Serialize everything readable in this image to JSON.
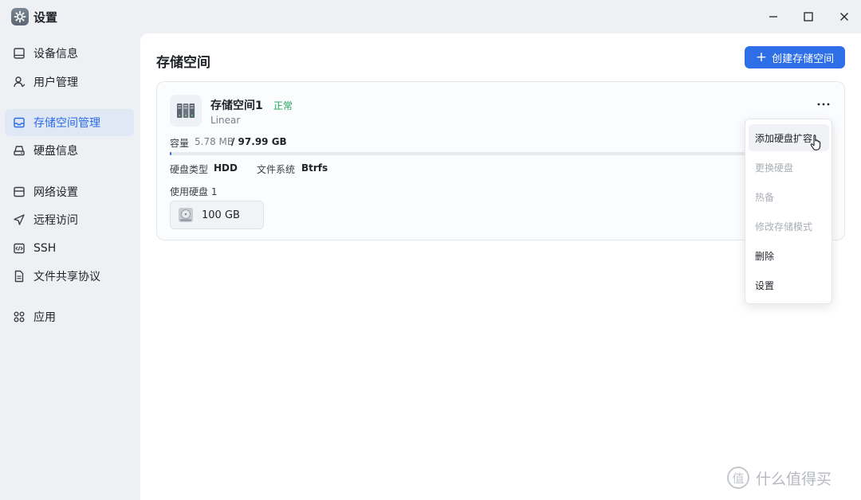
{
  "window": {
    "title": "设置"
  },
  "sidebar": {
    "items": [
      {
        "label": "设备信息",
        "icon": "device-icon",
        "active": false
      },
      {
        "label": "用户管理",
        "icon": "user-icon",
        "active": false
      },
      {
        "label": "存储空间管理",
        "icon": "storage-icon",
        "active": true
      },
      {
        "label": "硬盘信息",
        "icon": "disk-icon",
        "active": false
      },
      {
        "label": "网络设置",
        "icon": "network-icon",
        "active": false
      },
      {
        "label": "远程访问",
        "icon": "send-icon",
        "active": false
      },
      {
        "label": "SSH",
        "icon": "code-icon",
        "active": false
      },
      {
        "label": "文件共享协议",
        "icon": "document-icon",
        "active": false
      },
      {
        "label": "应用",
        "icon": "apps-icon",
        "active": false
      }
    ]
  },
  "main": {
    "title": "存储空间",
    "create_button": "创建存储空间",
    "pool": {
      "name": "存储空间1",
      "status": "正常",
      "mode": "Linear",
      "capacity_label": "容量",
      "capacity_used": "5.78 MB",
      "capacity_total": "/ 97.99 GB",
      "capacity_fraction": 0.0001,
      "disk_type_label": "硬盘类型",
      "disk_type": "HDD",
      "fs_label": "文件系统",
      "fs": "Btrfs",
      "used_disks_label": "使用硬盘 1",
      "disk_size": "100 GB"
    }
  },
  "menu": {
    "items": [
      {
        "label": "添加硬盘扩容",
        "state": "hover"
      },
      {
        "label": "更换硬盘",
        "state": "disabled"
      },
      {
        "label": "热备",
        "state": "disabled"
      },
      {
        "label": "修改存储模式",
        "state": "disabled"
      },
      {
        "label": "删除",
        "state": "normal"
      },
      {
        "label": "设置",
        "state": "normal"
      }
    ]
  },
  "watermark": {
    "text": "什么值得买",
    "badge": "值"
  },
  "colors": {
    "accent": "#2e6fe8",
    "status_ok": "#21a45a",
    "active_bg": "#e1e8f5"
  }
}
